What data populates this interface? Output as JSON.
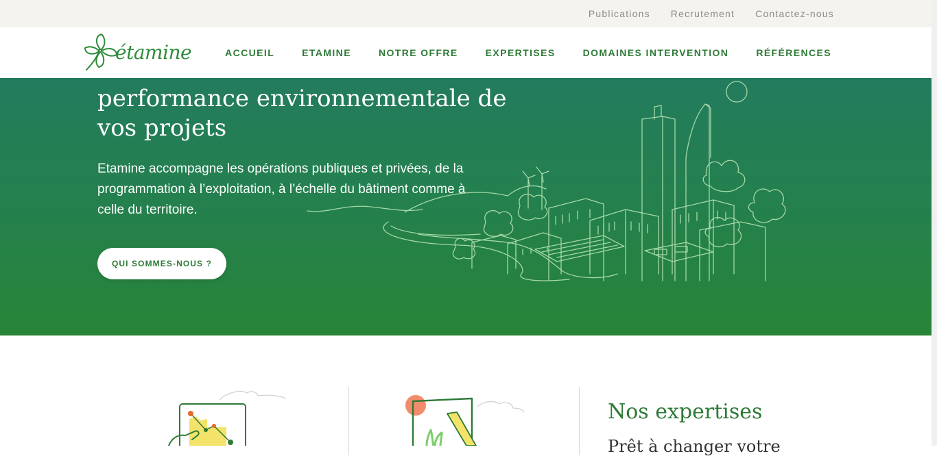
{
  "topbar": {
    "links": [
      "Publications",
      "Recrutement",
      "Contactez-nous"
    ]
  },
  "header": {
    "logo_text": "étamine",
    "nav": [
      "ACCUEIL",
      "ETAMINE",
      "NOTRE OFFRE",
      "EXPERTISES",
      "DOMAINES INTERVENTION",
      "RÉFÉRENCES"
    ]
  },
  "hero": {
    "title": "Etudes et conseils au service de la performance environnementale de vos projets",
    "subtitle": "Etamine accompagne les opérations publiques et privées, de la programmation à l’exploitation, à l’échelle du bâtiment comme à celle du territoire.",
    "button_label": "QUI SOMMES-NOUS ?"
  },
  "expertises": {
    "title": "Nos expertises",
    "subtitle": "Prêt à changer votre"
  },
  "colors": {
    "brand_green": "#2d7a36",
    "hero_top": "#227a64",
    "hero_bottom": "#278438",
    "topbar_bg": "#f4f3ee",
    "accent_yellow": "#f3e36a",
    "accent_coral": "#f28b6b"
  }
}
